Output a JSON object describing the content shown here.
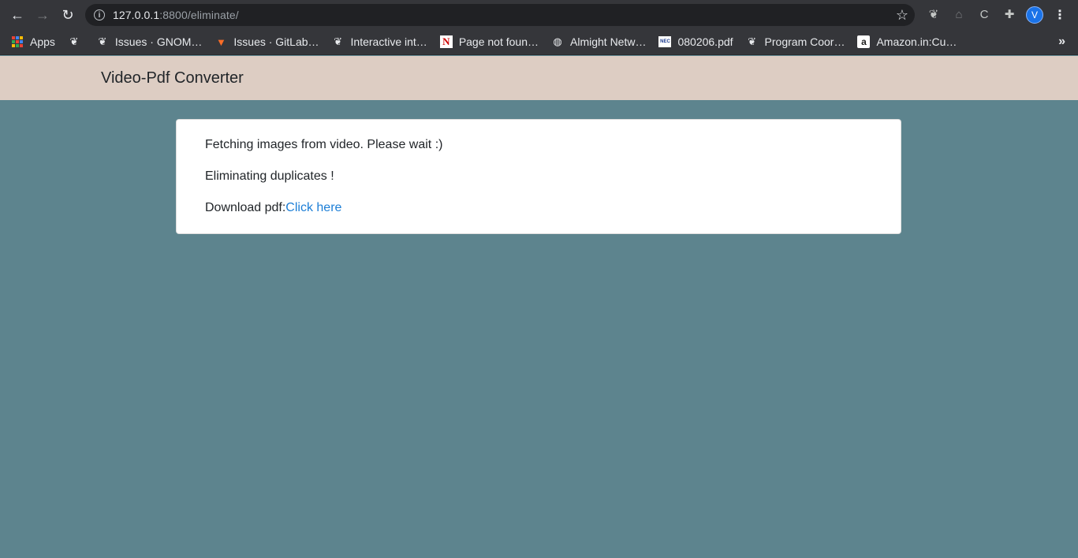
{
  "browser": {
    "url_host": "127.0.0.1",
    "url_rest": ":8800/eliminate/",
    "profile_initial": "V",
    "icons": {
      "back": "back-arrow-icon",
      "forward": "forward-arrow-icon",
      "reload": "reload-icon",
      "info": "info-icon",
      "star": "star-icon",
      "extensions": "puzzle-icon",
      "menu": "kebab-menu-icon"
    }
  },
  "bookmarks": [
    {
      "label": "Apps",
      "icon": "apps-grid-icon"
    },
    {
      "label": "",
      "icon": "gnome-foot-icon"
    },
    {
      "label": "Issues · GNOM…",
      "icon": "gnome-foot-icon"
    },
    {
      "label": "Issues · GitLab…",
      "icon": "gitlab-icon"
    },
    {
      "label": "Interactive int…",
      "icon": "gnome-foot-icon"
    },
    {
      "label": "Page not foun…",
      "icon": "n-logo-icon"
    },
    {
      "label": "Almight Netw…",
      "icon": "globe-icon"
    },
    {
      "label": "080206.pdf",
      "icon": "nec-logo-icon"
    },
    {
      "label": "Program Coor…",
      "icon": "gnome-foot-icon"
    },
    {
      "label": "Amazon.in:Cu…",
      "icon": "amazon-icon"
    }
  ],
  "bookmarks_overflow": "»",
  "page": {
    "brand": "Video-Pdf Converter",
    "status_fetching": "Fetching images from video. Please wait :)",
    "status_eliminating": "Eliminating duplicates !",
    "download_label": "Download pdf:",
    "download_link": "Click here"
  },
  "colors": {
    "page_background": "#5d848e",
    "navbar_background": "#ddcdc3",
    "link": "#1c7ed6"
  }
}
